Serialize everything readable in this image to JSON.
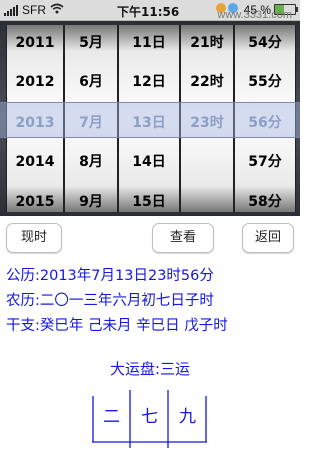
{
  "status_bar": {
    "carrier": "SFR",
    "time": "下午11:56",
    "battery": "45 %",
    "battery_level": 0.45,
    "watermark": "www.3331.com"
  },
  "picker": {
    "columns": [
      {
        "name": "year",
        "items": [
          "2011",
          "2012",
          "2013",
          "2014",
          "2015"
        ],
        "selected": "2013"
      },
      {
        "name": "month",
        "items": [
          "5月",
          "6月",
          "7月",
          "8月",
          "9月"
        ],
        "selected": "7月"
      },
      {
        "name": "day",
        "items": [
          "11日",
          "12日",
          "13日",
          "14日",
          "15日"
        ],
        "selected": "13日"
      },
      {
        "name": "hour",
        "items": [
          "21时",
          "22时",
          "23时",
          "",
          ""
        ],
        "selected": "23时"
      },
      {
        "name": "minute",
        "items": [
          "54分",
          "55分",
          "56分",
          "57分",
          "58分"
        ],
        "selected": "56分"
      }
    ]
  },
  "buttons": {
    "now": "现时",
    "view": "查看",
    "back": "返回"
  },
  "info": {
    "gregorian": "公历:2013年7月13日23时56分",
    "lunar": "农历:二〇一三年六月初七日子时",
    "ganzhi": "干支:癸巳年 己未月 辛巳日 戊子时"
  },
  "fortune": {
    "title": "大运盘:三运",
    "cells": [
      "二",
      "七",
      "九"
    ]
  },
  "colors": {
    "text_blue": "#1418e0",
    "selection_band": "#a5b4e1"
  },
  "icons": [
    "signal-icon",
    "wifi-icon",
    "battery-icon"
  ]
}
